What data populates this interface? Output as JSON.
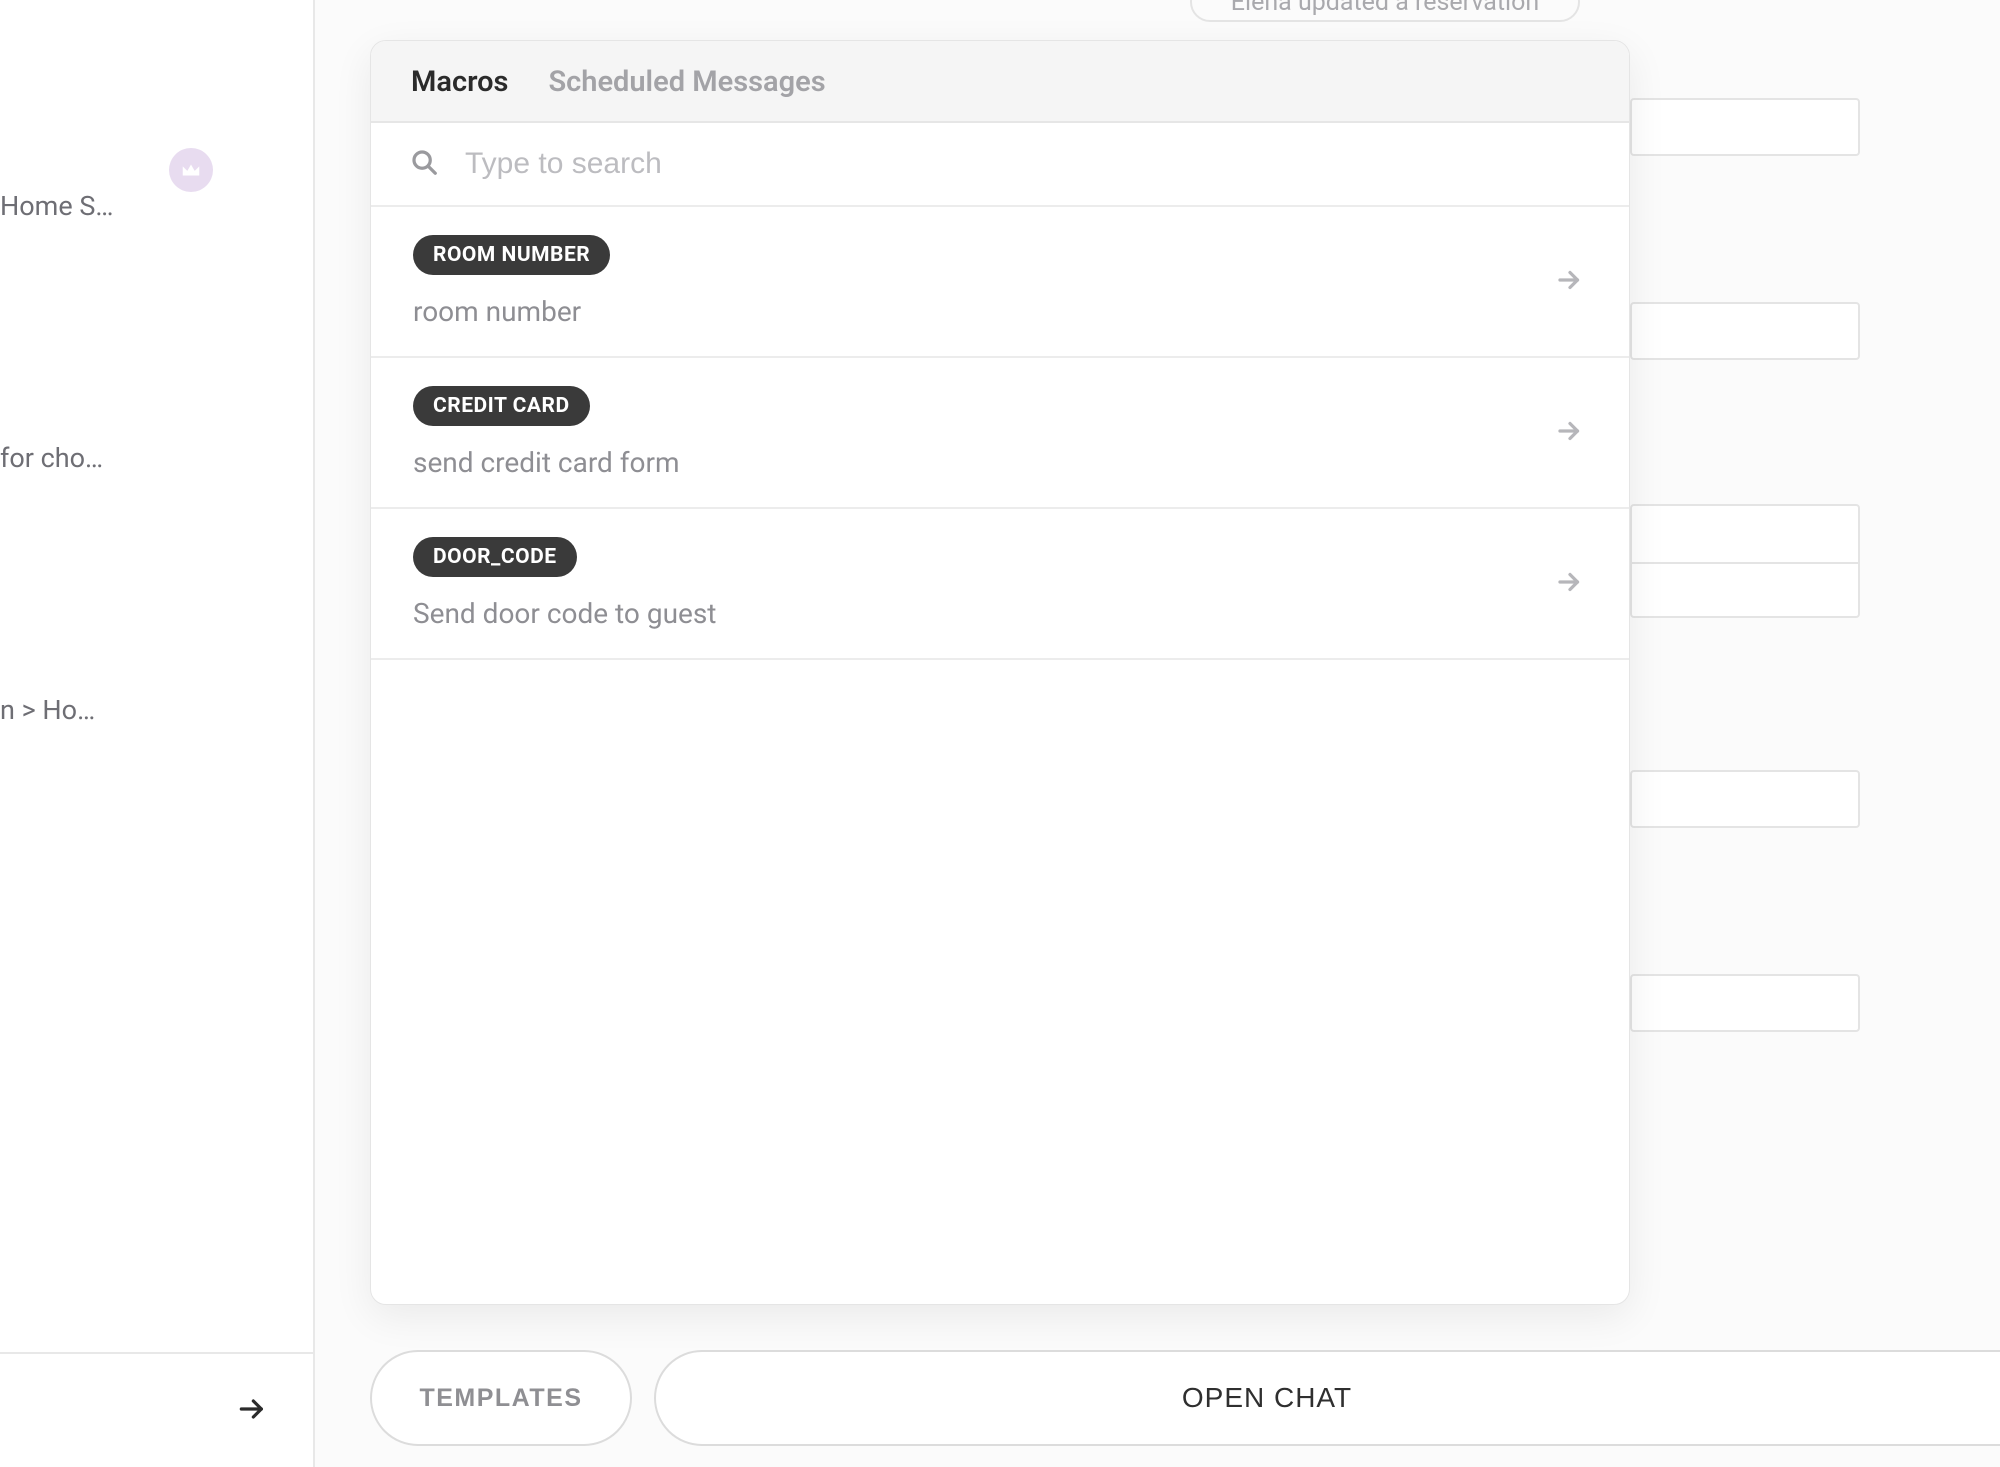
{
  "sidebar": {
    "item1": "Home S…",
    "item2": "for cho…",
    "item3": "n > Ho…"
  },
  "background": {
    "status_text": "Elena updated a reservation"
  },
  "panel": {
    "tabs": {
      "macros": "Macros",
      "scheduled": "Scheduled Messages"
    },
    "search_placeholder": "Type to search",
    "macros": [
      {
        "badge": "ROOM NUMBER",
        "desc": "room number"
      },
      {
        "badge": "CREDIT CARD",
        "desc": "send credit card form"
      },
      {
        "badge": "DOOR_CODE",
        "desc": "Send door code to guest"
      }
    ]
  },
  "bottom": {
    "templates": "TEMPLATES",
    "open_chat": "OPEN CHAT"
  }
}
